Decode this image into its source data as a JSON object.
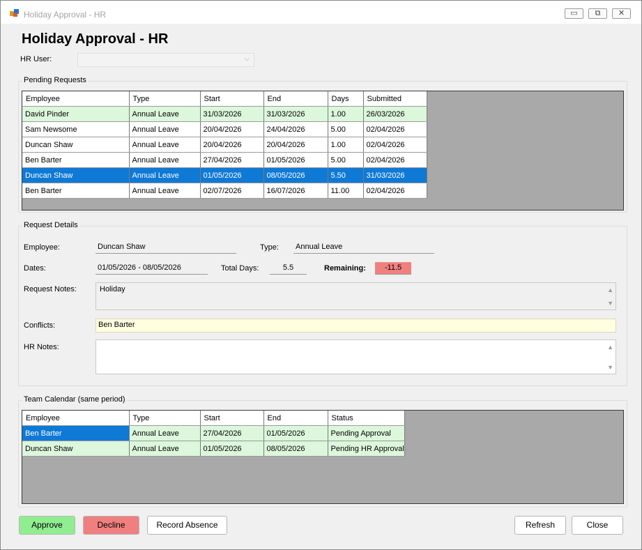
{
  "window": {
    "title": "Holiday Approval - HR"
  },
  "header": {
    "heading": "Holiday Approval - HR"
  },
  "hr_user": {
    "label": "HR User:",
    "value": ""
  },
  "pending": {
    "title": "Pending Requests",
    "columns": [
      "Employee",
      "Type",
      "Start",
      "End",
      "Days",
      "Submitted"
    ],
    "rows": [
      [
        "David Pinder",
        "Annual Leave",
        "31/03/2026",
        "31/03/2026",
        "1.00",
        "26/03/2026"
      ],
      [
        "Sam Newsome",
        "Annual Leave",
        "20/04/2026",
        "24/04/2026",
        "5.00",
        "02/04/2026"
      ],
      [
        "Duncan Shaw",
        "Annual Leave",
        "20/04/2026",
        "20/04/2026",
        "1.00",
        "02/04/2026"
      ],
      [
        "Ben Barter",
        "Annual Leave",
        "27/04/2026",
        "01/05/2026",
        "5.00",
        "02/04/2026"
      ],
      [
        "Duncan Shaw",
        "Annual Leave",
        "01/05/2026",
        "08/05/2026",
        "5.50",
        "31/03/2026"
      ],
      [
        "Ben Barter",
        "Annual Leave",
        "02/07/2026",
        "16/07/2026",
        "11.00",
        "02/04/2026"
      ]
    ]
  },
  "details": {
    "title": "Request Details",
    "employee_label": "Employee:",
    "employee": "Duncan Shaw",
    "type_label": "Type:",
    "type": "Annual Leave",
    "dates_label": "Dates:",
    "dates": "01/05/2026 - 08/05/2026",
    "total_days_label": "Total Days:",
    "total_days": "5.5",
    "remaining_label": "Remaining:",
    "remaining": "-11.5",
    "request_notes_label": "Request Notes:",
    "request_notes": "Holiday",
    "conflicts_label": "Conflicts:",
    "conflicts": "Ben Barter",
    "hr_notes_label": "HR Notes:",
    "hr_notes": ""
  },
  "calendar": {
    "title": "Team Calendar (same period)",
    "columns": [
      "Employee",
      "Type",
      "Start",
      "End",
      "Status"
    ],
    "rows": [
      [
        "Ben Barter",
        "Annual Leave",
        "27/04/2026",
        "01/05/2026",
        "Pending Approval"
      ],
      [
        "Duncan Shaw",
        "Annual Leave",
        "01/05/2026",
        "08/05/2026",
        "Pending HR Approval"
      ]
    ]
  },
  "buttons": {
    "approve": "Approve",
    "decline": "Decline",
    "record_absence": "Record Absence",
    "refresh": "Refresh",
    "close": "Close"
  },
  "icons": {
    "minimize": "▭",
    "maximize": "⧉",
    "close": "✕",
    "chevron": "⌵",
    "up": "▲",
    "down": "▼"
  },
  "colors": {
    "approve": "#90ee90",
    "decline": "#f08080",
    "selection": "#0f79d6",
    "row_green": "#dcf7dc",
    "remaining_bg": "#f08080",
    "conflicts_bg": "#ffffe0"
  }
}
